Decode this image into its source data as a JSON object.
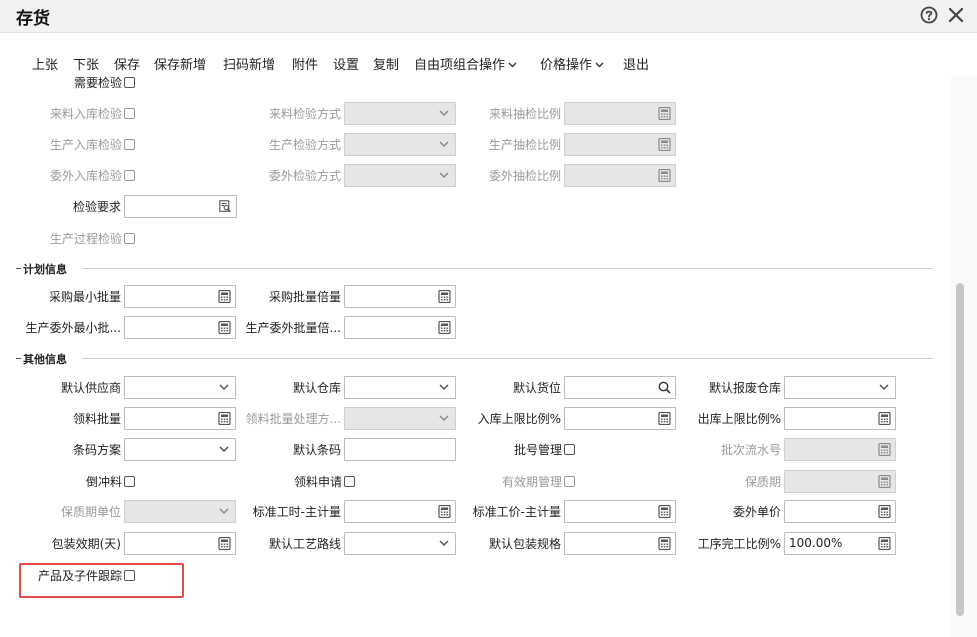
{
  "dialog": {
    "title": "存货"
  },
  "toolbar": {
    "prev": "上张",
    "next": "下张",
    "save": "保存",
    "save_new": "保存新增",
    "scan_new": "扫码新增",
    "attachment": "附件",
    "settings": "设置",
    "copy": "复制",
    "custom_combo": "自由项组合操作",
    "price_ops": "价格操作",
    "exit": "退出"
  },
  "sections": {
    "plan": "计划信息",
    "other": "其他信息"
  },
  "fields": [
    {
      "name": "need-inspection",
      "label": "需要检验",
      "type": "checkbox",
      "disabled": false
    },
    {
      "name": "incoming-inspection",
      "label": "来料入库检验",
      "type": "checkbox",
      "disabled": true
    },
    {
      "name": "incoming-inspection-method",
      "label": "来料检验方式",
      "type": "select",
      "disabled": true
    },
    {
      "name": "incoming-sampling-ratio",
      "label": "来料抽检比例",
      "type": "calc",
      "disabled": true
    },
    {
      "name": "production-inspection",
      "label": "生产入库检验",
      "type": "checkbox",
      "disabled": true
    },
    {
      "name": "production-inspection-method",
      "label": "生产检验方式",
      "type": "select",
      "disabled": true
    },
    {
      "name": "production-sampling-ratio",
      "label": "生产抽检比例",
      "type": "calc",
      "disabled": true
    },
    {
      "name": "outsource-inspection",
      "label": "委外入库检验",
      "type": "checkbox",
      "disabled": true
    },
    {
      "name": "outsource-inspection-method",
      "label": "委外检验方式",
      "type": "select",
      "disabled": true
    },
    {
      "name": "outsource-sampling-ratio",
      "label": "委外抽检比例",
      "type": "calc",
      "disabled": true
    },
    {
      "name": "inspection-requirement",
      "label": "检验要求",
      "type": "lookup",
      "disabled": false
    },
    {
      "name": "process-inspection",
      "label": "生产过程检验",
      "type": "checkbox",
      "disabled": true
    },
    {
      "name": "purchase-min-batch",
      "label": "采购最小批量",
      "type": "calc",
      "disabled": false
    },
    {
      "name": "purchase-batch-multiple",
      "label": "采购批量倍量",
      "type": "calc",
      "disabled": false
    },
    {
      "name": "prod-outsource-min-batch",
      "label": "生产委外最小批...",
      "type": "calc",
      "disabled": false
    },
    {
      "name": "prod-outsource-batch-multiple",
      "label": "生产委外批量倍...",
      "type": "calc",
      "disabled": false
    },
    {
      "name": "default-supplier",
      "label": "默认供应商",
      "type": "select",
      "disabled": false
    },
    {
      "name": "default-warehouse",
      "label": "默认仓库",
      "type": "select",
      "disabled": false
    },
    {
      "name": "default-location",
      "label": "默认货位",
      "type": "search",
      "disabled": false
    },
    {
      "name": "default-scrap-warehouse",
      "label": "默认报废仓库",
      "type": "select",
      "disabled": false
    },
    {
      "name": "picking-batch",
      "label": "领料批量",
      "type": "calc",
      "disabled": false
    },
    {
      "name": "picking-batch-method",
      "label": "领料批量处理方...",
      "type": "select",
      "disabled": true
    },
    {
      "name": "inbound-upper-ratio",
      "label": "入库上限比例%",
      "type": "calc",
      "disabled": false
    },
    {
      "name": "outbound-upper-ratio",
      "label": "出库上限比例%",
      "type": "calc",
      "disabled": false
    },
    {
      "name": "barcode-scheme",
      "label": "条码方案",
      "type": "select",
      "disabled": false
    },
    {
      "name": "default-barcode",
      "label": "默认条码",
      "type": "text",
      "disabled": false
    },
    {
      "name": "batch-management",
      "label": "批号管理",
      "type": "checkbox",
      "disabled": false
    },
    {
      "name": "batch-serial-number",
      "label": "批次流水号",
      "type": "calc",
      "disabled": true
    },
    {
      "name": "backflush-material",
      "label": "倒冲料",
      "type": "checkbox",
      "disabled": false
    },
    {
      "name": "picking-request",
      "label": "领料申请",
      "type": "checkbox",
      "disabled": false
    },
    {
      "name": "expiry-management",
      "label": "有效期管理",
      "type": "checkbox",
      "disabled": true
    },
    {
      "name": "shelf-life",
      "label": "保质期",
      "type": "calc",
      "disabled": true
    },
    {
      "name": "shelf-life-unit",
      "label": "保质期单位",
      "type": "select",
      "disabled": true
    },
    {
      "name": "std-hours-main-unit",
      "label": "标准工时-主计量",
      "type": "calc",
      "disabled": false
    },
    {
      "name": "std-price-main-unit",
      "label": "标准工价-主计量",
      "type": "calc",
      "disabled": false
    },
    {
      "name": "outsource-unit-price",
      "label": "委外单价",
      "type": "calc",
      "disabled": false
    },
    {
      "name": "packaging-validity-days",
      "label": "包装效期(天)",
      "type": "calc",
      "disabled": false
    },
    {
      "name": "default-process-route",
      "label": "默认工艺路线",
      "type": "select",
      "disabled": false
    },
    {
      "name": "default-packaging-spec",
      "label": "默认包装规格",
      "type": "calc",
      "disabled": false
    },
    {
      "name": "process-completion-ratio",
      "label": "工序完工比例%",
      "type": "calc",
      "disabled": false,
      "value": "100.00%"
    },
    {
      "name": "product-subpart-tracking",
      "label": "产品及子件跟踪",
      "type": "checkbox",
      "disabled": false
    }
  ]
}
